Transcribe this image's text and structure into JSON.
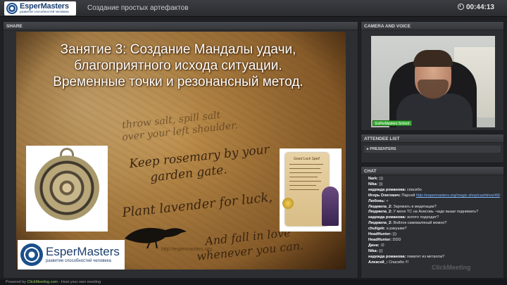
{
  "header": {
    "logo_name": "EsperMasters",
    "logo_tagline": "развитие способностей человека",
    "meeting_title": "Создание простых артефактов",
    "timer": "00:44:13"
  },
  "share": {
    "panel_label": "SHARE",
    "slide_title": "Занятие 3: Создание Мандалы удачи, благоприятного исхода ситуации. Временные точки и резонансный метод.",
    "script_lines": [
      "Keep rosemary by your",
      "garden gate.",
      "Plant lavender for luck,",
      "And fall in love",
      "whenever you can.",
      "throw salt, spill salt",
      "over your left shoulder."
    ],
    "scroll_title": "Good Luck Spell",
    "watermark": "http://espermasters.org",
    "logo_name": "EsperMasters",
    "logo_tagline": "развитие способностей человека"
  },
  "camera": {
    "panel_label": "CAMERA AND VOICE",
    "participant_label": "EsPerMasters School"
  },
  "attendees": {
    "panel_label": "ATTENDEE LIST",
    "group_label": "PRESENTERS"
  },
  "chat": {
    "panel_label": "CHAT",
    "messages": [
      {
        "author": "Nark:",
        "text": ")))"
      },
      {
        "author": "Nika:",
        "text": ")))"
      },
      {
        "author": "надежда романова:",
        "text": "спасибо"
      },
      {
        "author": "Игорь Олегович:",
        "text": "Парсей",
        "link": "http://espermasters.org/magic-shop/cashtrive/49/"
      },
      {
        "author": "Любовь:",
        "text": "+"
      },
      {
        "author": "Людмила_2:",
        "text": "Заряжать в медитации?"
      },
      {
        "author": "Людмила_2:",
        "text": "У меня ТС на Анисовь -чадо выше поднимать?"
      },
      {
        "author": "надежда романова:",
        "text": "золото подходит?"
      },
      {
        "author": "Людмила_2:",
        "text": "Войлок самоваляный можно?"
      },
      {
        "author": "chuligek:",
        "text": "а ракушки?"
      },
      {
        "author": "HeadHunter:",
        "text": ")))"
      },
      {
        "author": "HeadHunter:",
        "text": "DDD"
      },
      {
        "author": "Дина:",
        "text": ":D"
      },
      {
        "author": "Nika:",
        "text": "((("
      },
      {
        "author": "надежда романова:",
        "text": "гематит из металла?"
      },
      {
        "author": "Алексей_:",
        "text": "Спасибо !!!"
      }
    ],
    "watermark": "ClickMeeting"
  },
  "footer": {
    "prefix": "Powered by",
    "brand": "ClickMeeting.com",
    "suffix": "- Host your own meeting"
  }
}
